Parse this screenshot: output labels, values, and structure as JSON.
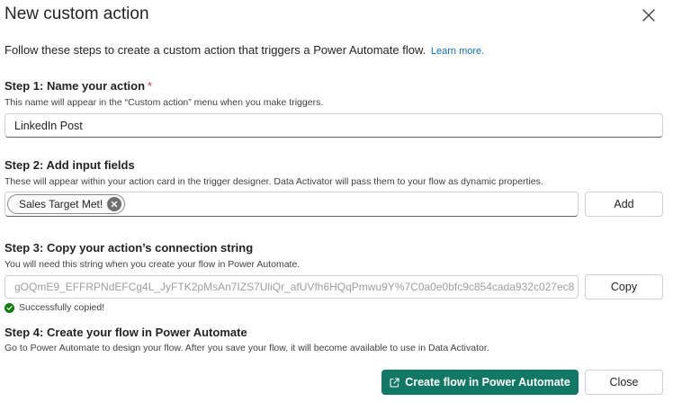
{
  "dialog": {
    "title": "New custom action",
    "intro_text": "Follow these steps to create a custom action that triggers a Power Automate flow.",
    "learn_more": "Learn more."
  },
  "step1": {
    "title": "Step 1: Name your action",
    "required_mark": "*",
    "description": "This name will appear in the “Custom action” menu when you make triggers.",
    "name_value": "LinkedIn Post"
  },
  "step2": {
    "title": "Step 2: Add input fields",
    "description": "These will appear within your action card in the trigger designer. Data Activator will pass them to your flow as dynamic properties.",
    "chip_label": "Sales Target Met!",
    "add_button": "Add"
  },
  "step3": {
    "title": "Step 3: Copy your action’s connection string",
    "description": "You will need this string when you create your flow in Power Automate.",
    "connection_string": "gOQmE9_EFFRPNdEFCg4L_JyFTK2pMsAn7IZS7UliQr_afUVfh6HQqPmwu9Y%7C0a0e0bfc9c854cada932c027ec8",
    "copy_button": "Copy",
    "success_text": "Successfully copied!"
  },
  "step4": {
    "title": "Step 4: Create your flow in Power Automate",
    "description": "Go to Power Automate to design your flow. After you save your flow, it will become available to use in Data Activator."
  },
  "footer": {
    "create_flow_button": "Create flow in Power Automate",
    "close_button": "Close"
  },
  "icons": {
    "close": "close-icon",
    "chip_remove": "dismiss-circle-icon",
    "success": "checkmark-circle-icon",
    "external": "open-external-icon"
  },
  "colors": {
    "primary": "#117865",
    "link": "#0f6cbd",
    "required": "#c4314b",
    "success": "#107c10"
  }
}
